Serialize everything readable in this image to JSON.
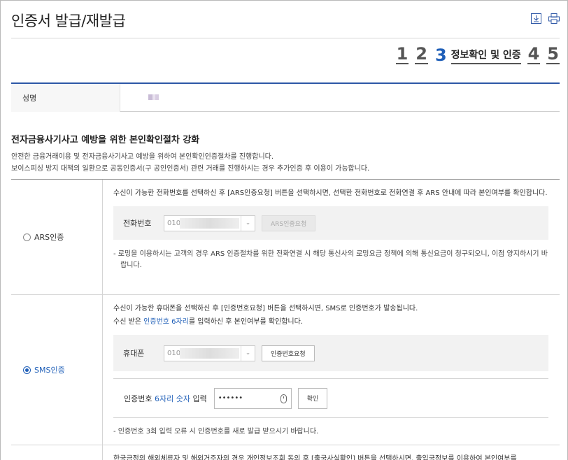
{
  "page": {
    "title": "인증서 발급/재발급"
  },
  "toolbar": {
    "download_icon": "download-icon",
    "print_icon": "printer-icon"
  },
  "steps": {
    "items": [
      "1",
      "2",
      "3",
      "4",
      "5"
    ],
    "active_label": "정보확인 및 인증"
  },
  "name_row": {
    "label": "성명"
  },
  "section": {
    "title": "전자금융사기사고 예방을 위한 본인확인절차 강화",
    "desc1": "안전한 금융거래이용 및 전자금융사기사고 예방을 위하여 본인확인인증절차를 진행합니다.",
    "desc2": "보이스피싱 방지 대책의 일환으로 공동인증서(구 공인인증서) 관련 거래를 진행하시는 경우 추가인증 후 이용이 가능합니다."
  },
  "ars": {
    "label": "ARS인증",
    "selected": false,
    "para": "수신이 가능한 전화번호를 선택하신 후 [ARS인증요청] 버튼을 선택하시면, 선택한 전화번호로 전화연결 후 ARS 안내에 따라 본인여부를 확인합니다.",
    "phone_label": "전화번호",
    "phone_value": "010",
    "request_button": "ARS인증요청",
    "note": "- 로밍을 이용하시는 고객의 경우 ARS 인증절차를 위한 전화연결 시 해당 통신사의 로밍요금 정책에 의해 통신요금이 청구되오니, 이점 양지하시기 바랍니다."
  },
  "sms": {
    "label": "SMS인증",
    "selected": true,
    "para1": "수신이 가능한 휴대폰을 선택하신 후 [인증번호요청] 버튼을 선택하시면, SMS로 인증번호가 발송됩니다.",
    "para2_prefix": "수신 받은 ",
    "para2_highlight": "인증번호 6자리",
    "para2_suffix": "를 입력하신 후 본인여부를 확인합니다.",
    "phone_label": "휴대폰",
    "phone_value": "010",
    "request_button": "인증번호요청",
    "code_label_prefix": "인증번호 ",
    "code_label_highlight": "6자리 숫자",
    "code_label_suffix": " 입력",
    "code_value": "••••••",
    "confirm_button": "확인",
    "note": "- 인증번호 3회 입력 오류 시 인증번호를 새로 발급 받으시기 바랍니다."
  },
  "next_option": {
    "para": "한국금정의 해외체류자 및 해외거주자의 경우 개인정보조회 동의 후 [출국사실확인] 버튼을 선택하시면, 출입국정보를 이용하여 본인여부를"
  },
  "colors": {
    "accent": "#1f5fb8",
    "top_border": "#2d57a6"
  }
}
